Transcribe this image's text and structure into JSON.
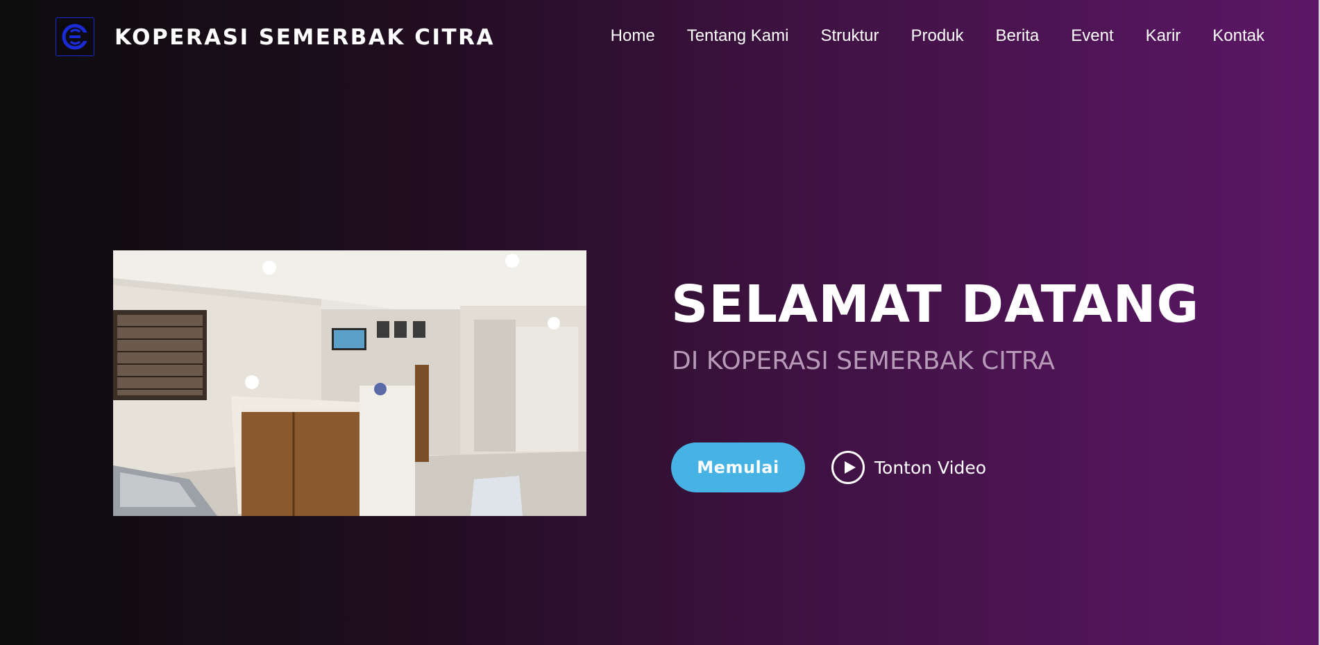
{
  "brand": {
    "name": "KOPERASI SEMERBAK CITRA",
    "logo_icon": "ksc-logo-icon",
    "logo_color": "#1a2bd6"
  },
  "nav": {
    "items": [
      {
        "label": "Home"
      },
      {
        "label": "Tentang Kami"
      },
      {
        "label": "Struktur"
      },
      {
        "label": "Produk"
      },
      {
        "label": "Berita"
      },
      {
        "label": "Event"
      },
      {
        "label": "Karir"
      },
      {
        "label": "Kontak"
      }
    ]
  },
  "hero": {
    "title": "SELAMAT DATANG",
    "subtitle": "DI KOPERASI SEMERBAK CITRA",
    "start_button": "Memulai",
    "video_button": "Tonton Video",
    "play_icon": "play-icon",
    "image_subject": "office-reception-photo"
  },
  "colors": {
    "accent": "#47b2e4",
    "subtitle": "#b69ab8",
    "bg_start": "#0d0d0d",
    "bg_end": "#5c1766"
  }
}
